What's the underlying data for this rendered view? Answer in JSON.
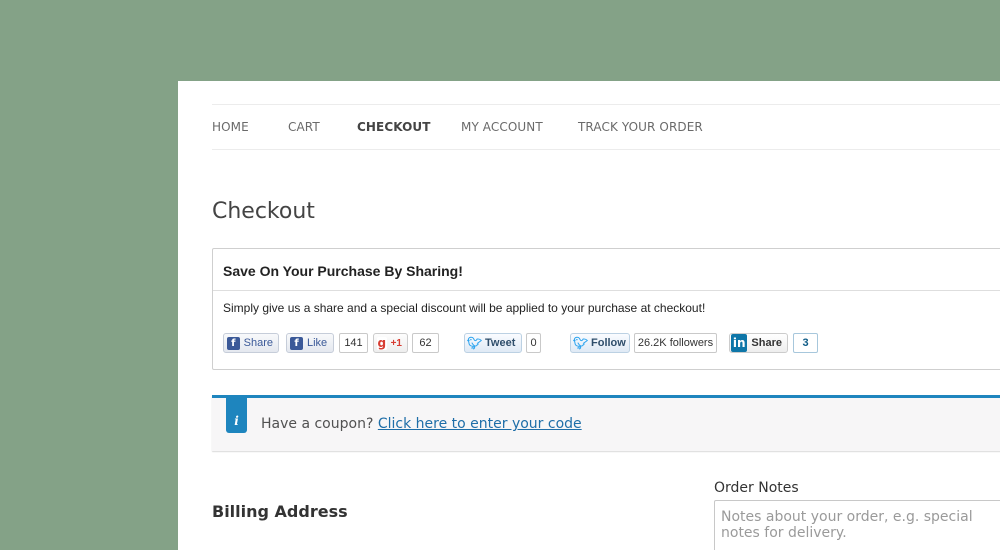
{
  "nav": {
    "items": [
      {
        "label": "HOME"
      },
      {
        "label": "CART"
      },
      {
        "label": "CHECKOUT"
      },
      {
        "label": "MY ACCOUNT"
      },
      {
        "label": "TRACK YOUR ORDER"
      }
    ],
    "active": "CHECKOUT"
  },
  "page": {
    "title": "Checkout"
  },
  "share": {
    "title": "Save On Your Purchase By Sharing!",
    "description": "Simply give us a share and a special discount will be applied to your purchase at checkout!",
    "facebook_share": {
      "label": "Share"
    },
    "facebook_like": {
      "label": "Like",
      "count": "141"
    },
    "google_plus": {
      "icon_text": "g",
      "label": "+1",
      "count": "62"
    },
    "twitter_tweet": {
      "label": "Tweet",
      "count": "0"
    },
    "twitter_follow": {
      "label": "Follow",
      "count": "26.2K followers"
    },
    "linkedin_share": {
      "icon_text": "in",
      "label": "Share",
      "count": "3"
    }
  },
  "coupon": {
    "icon_text": "i",
    "prompt": "Have a coupon?",
    "link": "Click here to enter your code"
  },
  "billing": {
    "title": "Billing Address"
  },
  "order_notes": {
    "label": "Order Notes",
    "placeholder": "Notes about your order, e.g. special notes for delivery."
  },
  "colors": {
    "background": "#84a287",
    "accent": "#1e85be",
    "facebook": "#3b5998",
    "twitter": "#2aa3ef",
    "google": "#d73d32",
    "linkedin": "#0e76a8"
  }
}
